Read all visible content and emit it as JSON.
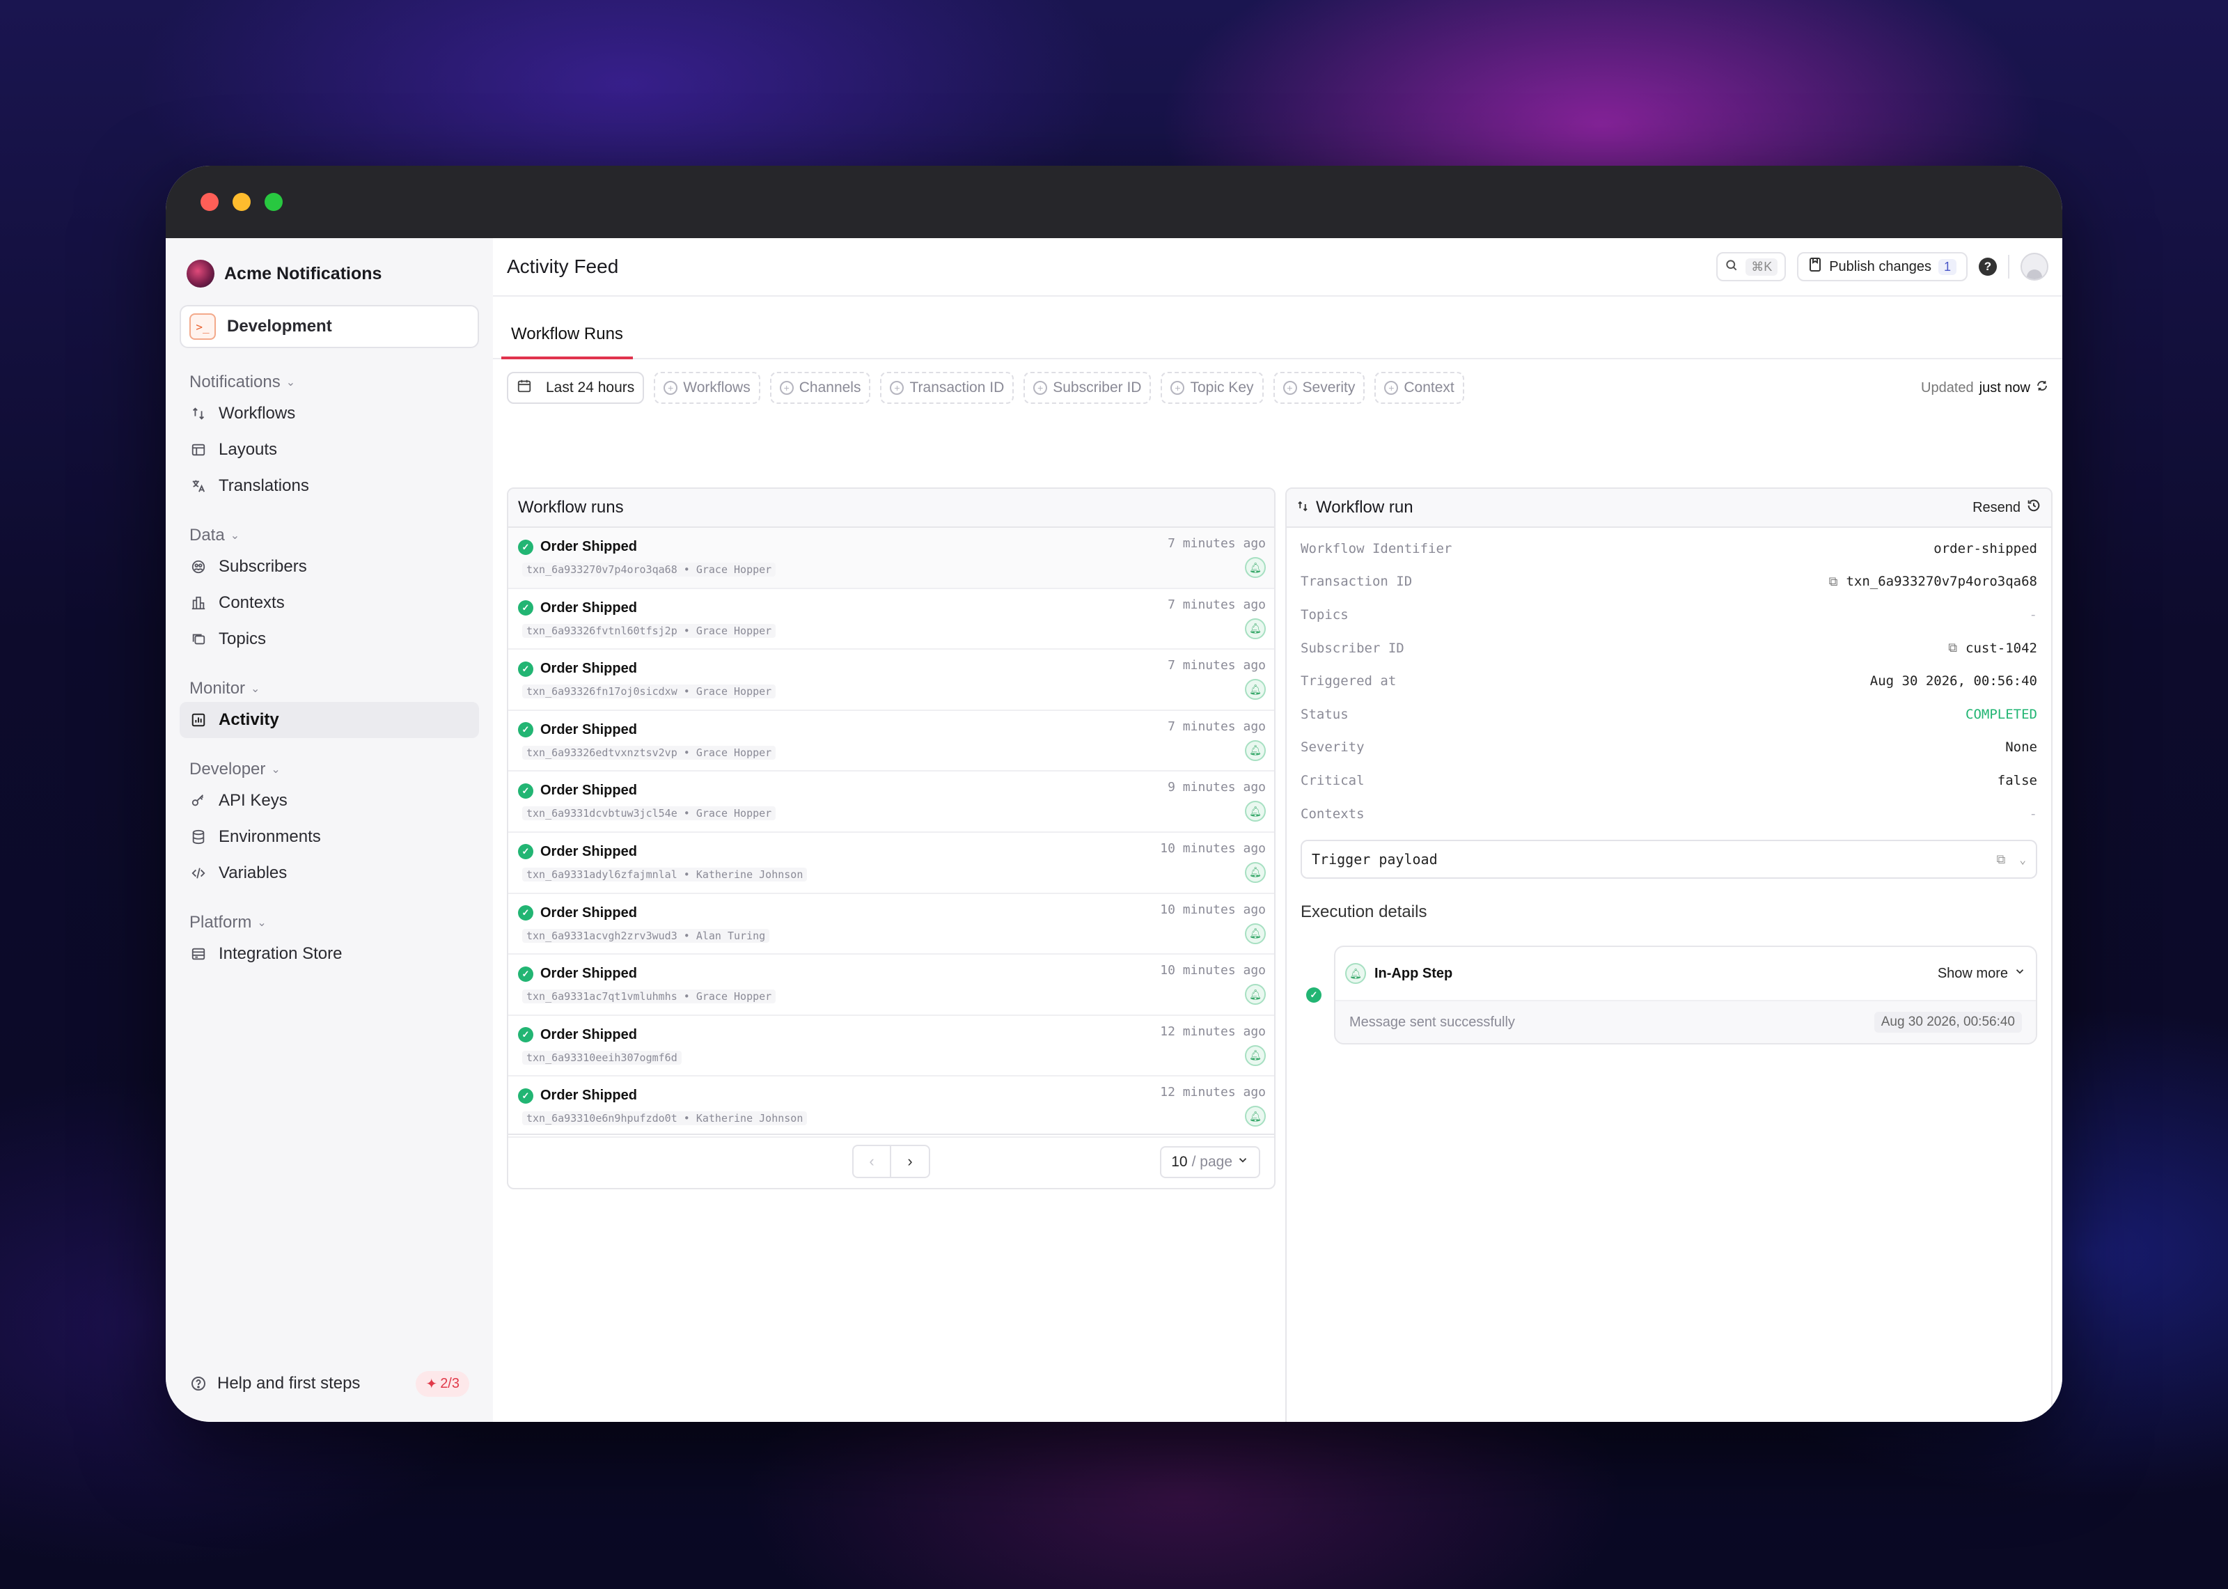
{
  "org": {
    "name": "Acme Notifications"
  },
  "environment": {
    "label": "Development"
  },
  "sidebar": {
    "sections": [
      {
        "title": "Notifications",
        "items": [
          {
            "label": "Workflows",
            "icon": "workflow-icon"
          },
          {
            "label": "Layouts",
            "icon": "layout-icon"
          },
          {
            "label": "Translations",
            "icon": "translate-icon"
          }
        ]
      },
      {
        "title": "Data",
        "items": [
          {
            "label": "Subscribers",
            "icon": "subscribers-icon"
          },
          {
            "label": "Contexts",
            "icon": "contexts-icon"
          },
          {
            "label": "Topics",
            "icon": "topics-icon"
          }
        ]
      },
      {
        "title": "Monitor",
        "items": [
          {
            "label": "Activity",
            "icon": "activity-icon",
            "active": true
          }
        ]
      },
      {
        "title": "Developer",
        "items": [
          {
            "label": "API Keys",
            "icon": "key-icon"
          },
          {
            "label": "Environments",
            "icon": "database-icon"
          },
          {
            "label": "Variables",
            "icon": "code-icon"
          }
        ]
      },
      {
        "title": "Platform",
        "items": [
          {
            "label": "Integration Store",
            "icon": "store-icon"
          }
        ]
      }
    ],
    "help": {
      "label": "Help and first steps",
      "progress": "2/3"
    }
  },
  "header": {
    "title": "Activity Feed",
    "search_shortcut": "⌘K",
    "publish_label": "Publish changes",
    "publish_count": "1"
  },
  "tabs": [
    {
      "label": "Workflow Runs",
      "active": true
    }
  ],
  "filters": {
    "date": "Last 24 hours",
    "options": [
      "Workflows",
      "Channels",
      "Transaction ID",
      "Subscriber ID",
      "Topic Key",
      "Severity",
      "Context"
    ],
    "updated_prefix": "Updated",
    "updated_value": "just now"
  },
  "runs": {
    "title": "Workflow runs",
    "rows": [
      {
        "name": "Order Shipped",
        "meta": "txn_6a933270v7p4oro3qa68 • Grace Hopper",
        "time": "7 minutes ago"
      },
      {
        "name": "Order Shipped",
        "meta": "txn_6a93326fvtnl60tfsj2p • Grace Hopper",
        "time": "7 minutes ago"
      },
      {
        "name": "Order Shipped",
        "meta": "txn_6a93326fn17oj0sicdxw • Grace Hopper",
        "time": "7 minutes ago"
      },
      {
        "name": "Order Shipped",
        "meta": "txn_6a93326edtvxnztsv2vp • Grace Hopper",
        "time": "7 minutes ago"
      },
      {
        "name": "Order Shipped",
        "meta": "txn_6a9331dcvbtuw3jcl54e • Grace Hopper",
        "time": "9 minutes ago"
      },
      {
        "name": "Order Shipped",
        "meta": "txn_6a9331adyl6zfajmnlal • Katherine Johnson",
        "time": "10 minutes ago"
      },
      {
        "name": "Order Shipped",
        "meta": "txn_6a9331acvgh2zrv3wud3 • Alan Turing",
        "time": "10 minutes ago"
      },
      {
        "name": "Order Shipped",
        "meta": "txn_6a9331ac7qt1vmluhmhs • Grace Hopper",
        "time": "10 minutes ago"
      },
      {
        "name": "Order Shipped",
        "meta": "txn_6a93310eeih307ogmf6d",
        "time": "12 minutes ago"
      },
      {
        "name": "Order Shipped",
        "meta": "txn_6a93310e6n9hpufzdo0t • Katherine Johnson",
        "time": "12 minutes ago"
      }
    ],
    "pagination": {
      "per_page": "10",
      "per_page_suffix": "/ page"
    }
  },
  "detail": {
    "title": "Workflow run",
    "resend_label": "Resend",
    "fields": [
      {
        "key": "Workflow Identifier",
        "value": "order-shipped"
      },
      {
        "key": "Transaction ID",
        "value": "txn_6a933270v7p4oro3qa68",
        "copy": true
      },
      {
        "key": "Topics",
        "value": "-",
        "style": "dash"
      },
      {
        "key": "Subscriber ID",
        "value": "cust-1042",
        "copy": true
      },
      {
        "key": "Triggered at",
        "value": "Aug 30 2026, 00:56:40"
      },
      {
        "key": "Status",
        "value": "COMPLETED",
        "style": "green"
      },
      {
        "key": "Severity",
        "value": "None"
      },
      {
        "key": "Critical",
        "value": "false"
      },
      {
        "key": "Contexts",
        "value": "-",
        "style": "dash"
      }
    ],
    "payload_label": "Trigger payload",
    "execution_title": "Execution details",
    "step": {
      "name": "In-App Step",
      "show_more": "Show more",
      "message": "Message sent successfully",
      "timestamp": "Aug 30 2026, 00:56:40"
    }
  },
  "colors": {
    "accent": "#e0334d",
    "success": "#22b573"
  }
}
